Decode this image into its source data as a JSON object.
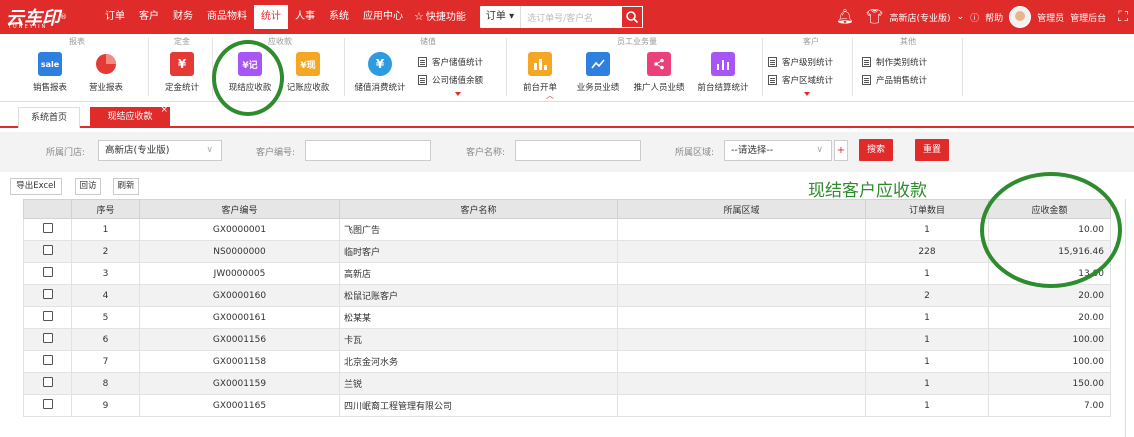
{
  "brand": {
    "logo": "云车印",
    "sub": "YUNEYIIN",
    "reg": "®"
  },
  "menu": [
    "订单",
    "客户",
    "财务",
    "商品物料",
    "统计",
    "人事",
    "系统",
    "应用中心"
  ],
  "quick": "快捷功能",
  "order_search": {
    "select": "订单",
    "placeholder": "选订单号/客户名"
  },
  "topright": {
    "store": "高新店(专业版)",
    "help": "帮助",
    "user": "管理员",
    "admin": "管理后台"
  },
  "ribbon": {
    "groups": [
      "报表",
      "定金",
      "应收款",
      "储值",
      "员工业务量",
      "客户",
      "其他"
    ],
    "report": [
      {
        "label": "销售报表",
        "icon": "sale",
        "color": "#2d7fe0"
      },
      {
        "label": "营业报表",
        "icon": "pie-chart-icon",
        "color": "#e53935"
      }
    ],
    "deposit": [
      {
        "label": "定金统计",
        "icon": "¥",
        "color": "#e53935"
      }
    ],
    "receivable": [
      {
        "label": "现结应收款",
        "icon": "¥记",
        "color": "#a855f7"
      },
      {
        "label": "记账应收款",
        "icon": "¥现",
        "color": "#f5a623"
      }
    ],
    "stored": [
      {
        "label": "储值消费统计",
        "icon": "¥",
        "color": "#2d9be0"
      }
    ],
    "stored_small": [
      "客户储值统计",
      "公司储值余额"
    ],
    "staff": [
      {
        "label": "前台开单",
        "icon": "bar-chart-icon",
        "color": "#f5a623"
      },
      {
        "label": "业务员业绩",
        "icon": "line-chart-icon",
        "color": "#2d7fe0"
      },
      {
        "label": "推广人员业绩",
        "icon": "share-icon",
        "color": "#ec407a"
      },
      {
        "label": "前台结算统计",
        "icon": "bar-chart-icon",
        "color": "#a855f7"
      }
    ],
    "customer_small": [
      "客户级别统计",
      "客户区域统计"
    ],
    "other_small": [
      "制作类别统计",
      "产品销售统计"
    ]
  },
  "tabs": {
    "home": "系统首页",
    "current": "现结应收款",
    "close": "×"
  },
  "filter": {
    "store_label": "所属门店:",
    "store_value": "高新店(专业版)",
    "code_label": "客户编号:",
    "name_label": "客户名称:",
    "area_label": "所属区域:",
    "area_value": "--请选择--",
    "search_btn": "搜索",
    "reset_btn": "重置"
  },
  "toolbar": [
    "导出Excel",
    "回访",
    "刷新"
  ],
  "annotation": "现结客户应收款",
  "table": {
    "columns": [
      "",
      "序号",
      "客户编号",
      "客户名称",
      "所属区域",
      "订单数目",
      "应收金额"
    ],
    "rows": [
      [
        "1",
        "GX0000001",
        "飞图广告",
        "",
        "1",
        "10.00"
      ],
      [
        "2",
        "NS0000000",
        "临时客户",
        "",
        "228",
        "15,916.46"
      ],
      [
        "3",
        "JW0000005",
        "高新店",
        "",
        "1",
        "13.00"
      ],
      [
        "4",
        "GX0000160",
        "松鼠记账客户",
        "",
        "2",
        "20.00"
      ],
      [
        "5",
        "GX0000161",
        "松某某",
        "",
        "1",
        "20.00"
      ],
      [
        "6",
        "GX0001156",
        "卡瓦",
        "",
        "1",
        "100.00"
      ],
      [
        "7",
        "GX0001158",
        "北京金河水务",
        "",
        "1",
        "100.00"
      ],
      [
        "8",
        "GX0001159",
        "兰锐",
        "",
        "1",
        "150.00"
      ],
      [
        "9",
        "GX0001165",
        "四川岷裔工程管理有限公司",
        "",
        "1",
        "7.00"
      ]
    ]
  }
}
